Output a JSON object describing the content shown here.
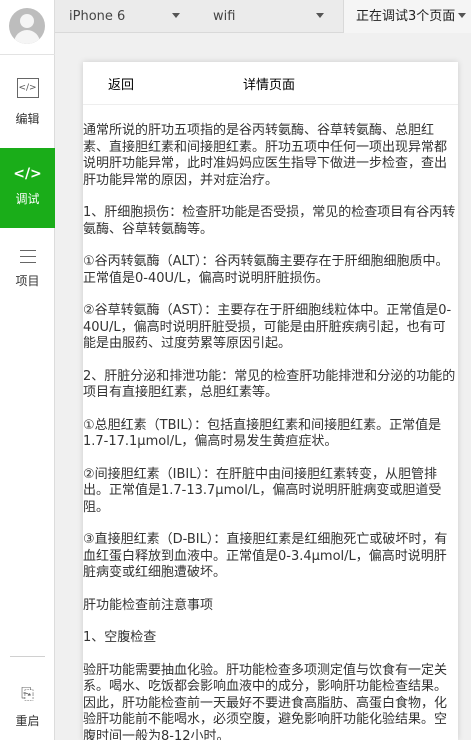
{
  "sidebar": {
    "items": [
      {
        "label": "编辑",
        "icon": "code-icon"
      },
      {
        "label": "调试",
        "icon": "code-icon"
      },
      {
        "label": "项目",
        "icon": "menu-icon"
      }
    ],
    "restart_label": "重启",
    "active_color": "#1aad19"
  },
  "toolbar": {
    "device": "iPhone 6",
    "network": "wifi",
    "debug_pages": "正在调试3个页面"
  },
  "page": {
    "back_label": "返回",
    "title": "详情页面",
    "paragraphs": [
      "通常所说的肝功五项指的是谷丙转氨酶、谷草转氨酶、总胆红素、直接胆红素和间接胆红素。肝功五项中任何一项出现异常都说明肝功能异常，此时准妈妈应医生指导下做进一步检查，查出肝功能异常的原因，并对症治疗。",
      "1、肝细胞损伤：检查肝功能是否受损，常见的检查项目有谷丙转氨酶、谷草转氨酶等。",
      "①谷丙转氨酶（ALT）：谷丙转氨酶主要存在于肝细胞细胞质中。正常值是0-40U/L，偏高时说明肝脏损伤。",
      "②谷草转氨酶（AST）：主要存在于肝细胞线粒体中。正常值是0-40U/L，偏高时说明肝脏受损，可能是由肝脏疾病引起，也有可能是由服药、过度劳累等原因引起。",
      "2、肝脏分泌和排泄功能：常见的检查肝功能排泄和分泌的功能的项目有直接胆红素，总胆红素等。",
      "①总胆红素（TBIL）：包括直接胆红素和间接胆红素。正常值是1.7-17.1μmol/L，偏高时易发生黄疸症状。",
      "②间接胆红素（IBIL）：在肝脏中由间接胆红素转变，从胆管排出。正常值是1.7-13.7μmol/L，偏高时说明肝脏病变或胆道受阻。",
      "③直接胆红素（D-BIL）：直接胆红素是红细胞死亡或破坏时，有血红蛋白释放到血液中。正常值是0-3.4μmol/L，偏高时说明肝脏病变或红细胞遭破坏。",
      "肝功能检查前注意事项",
      "1、空腹检查",
      "验肝功能需要抽血化验。肝功能检查多项测定值与饮食有一定关系。喝水、吃饭都会影响血液中的成分，影响肝功能检查结果。因此，肝功能检查前一天最好不要进食高脂肪、高蛋白食物，化验肝功能前不能喝水，必须空腹，避免影响肝功能化验结果。空腹时间一般为8-12小时。"
    ]
  }
}
